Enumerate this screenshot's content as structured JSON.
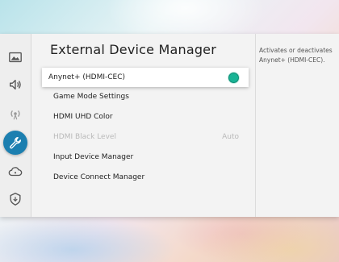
{
  "page": {
    "title": "External Device Manager",
    "description": "Activates or deactivates Anynet+ (HDMI-CEC)."
  },
  "sidebar": {
    "icons": [
      {
        "name": "picture-icon",
        "selected": false
      },
      {
        "name": "sound-icon",
        "selected": false
      },
      {
        "name": "broadcasting-icon",
        "selected": false
      },
      {
        "name": "general-wrench-icon",
        "selected": true
      },
      {
        "name": "support-cloud-icon",
        "selected": false
      },
      {
        "name": "privacy-shield-icon",
        "selected": false
      }
    ]
  },
  "menu": {
    "items": [
      {
        "label": "Anynet+ (HDMI-CEC)",
        "state": "on",
        "focused": true
      },
      {
        "label": "Game Mode Settings"
      },
      {
        "label": "HDMI UHD Color"
      },
      {
        "label": "HDMI Black Level",
        "value": "Auto",
        "disabled": true
      },
      {
        "label": "Input Device Manager"
      },
      {
        "label": "Device Connect Manager"
      }
    ]
  },
  "colors": {
    "accent_selected": "#1c7fb0",
    "toggle_on": "#19b395"
  }
}
